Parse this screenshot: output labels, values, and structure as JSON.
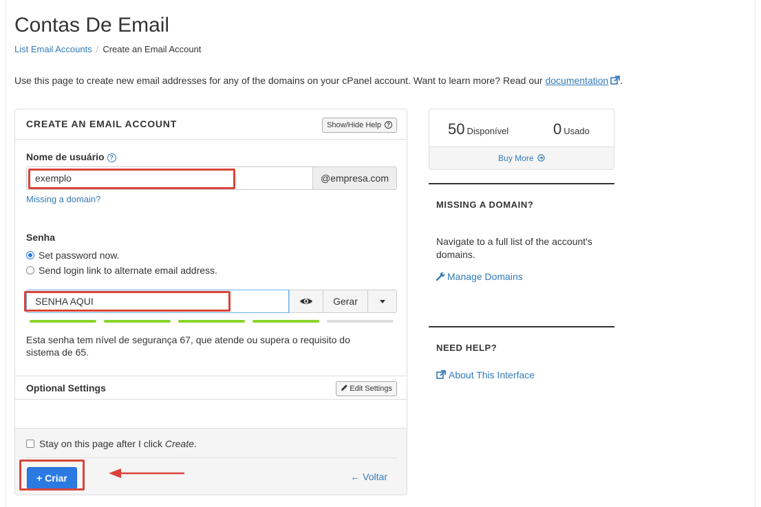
{
  "page": {
    "title": "Contas De Email",
    "intro_text": "Use this page to create new email addresses for any of the domains on your cPanel account. Want to learn more? Read our",
    "intro_link": "documentation",
    "intro_end": "."
  },
  "breadcrumb": {
    "parent": "List Email Accounts",
    "separator": "/",
    "current": "Create an Email Account"
  },
  "form": {
    "header": "CREATE AN EMAIL ACCOUNT",
    "help_button": "Show/Hide Help",
    "username_label": "Nome de usuário",
    "username_value": "exemplo",
    "domain_addon": "@empresa.com",
    "missing_domain_link": "Missing a domain?",
    "password_label": "Senha",
    "radio_set_now": "Set password now.",
    "radio_send_link": "Send login link to alternate email address.",
    "password_value": "SENHA AQUI",
    "generate_button": "Gerar",
    "strength_text": "Esta senha tem nível de segurança 67, que atende ou supera o requisito do sistema de 65.",
    "strength_segments_filled": 4,
    "strength_segments_total": 5,
    "optional_header": "Optional Settings",
    "edit_settings_button": "Edit Settings",
    "stay_checkbox_text": "Stay on this page after I click",
    "stay_checkbox_em": "Create",
    "stay_checkbox_end": ".",
    "create_button": "+ Criar",
    "back_link": "← Voltar"
  },
  "stats": {
    "available_count": "50",
    "available_label": "Disponível",
    "used_count": "0",
    "used_label": "Usado",
    "buy_more": "Buy More"
  },
  "sidebar": {
    "missing_domain_heading": "MISSING A DOMAIN?",
    "missing_domain_text": "Navigate to a full list of the account's domains.",
    "manage_domains_link": "Manage Domains",
    "need_help_heading": "NEED HELP?",
    "about_link": "About This Interface"
  },
  "colors": {
    "accent": "#2a7ae2",
    "link": "#337ab7",
    "highlight": "#d9433a",
    "strength_filled": "#8ad52a",
    "strength_empty": "#dddddd"
  }
}
